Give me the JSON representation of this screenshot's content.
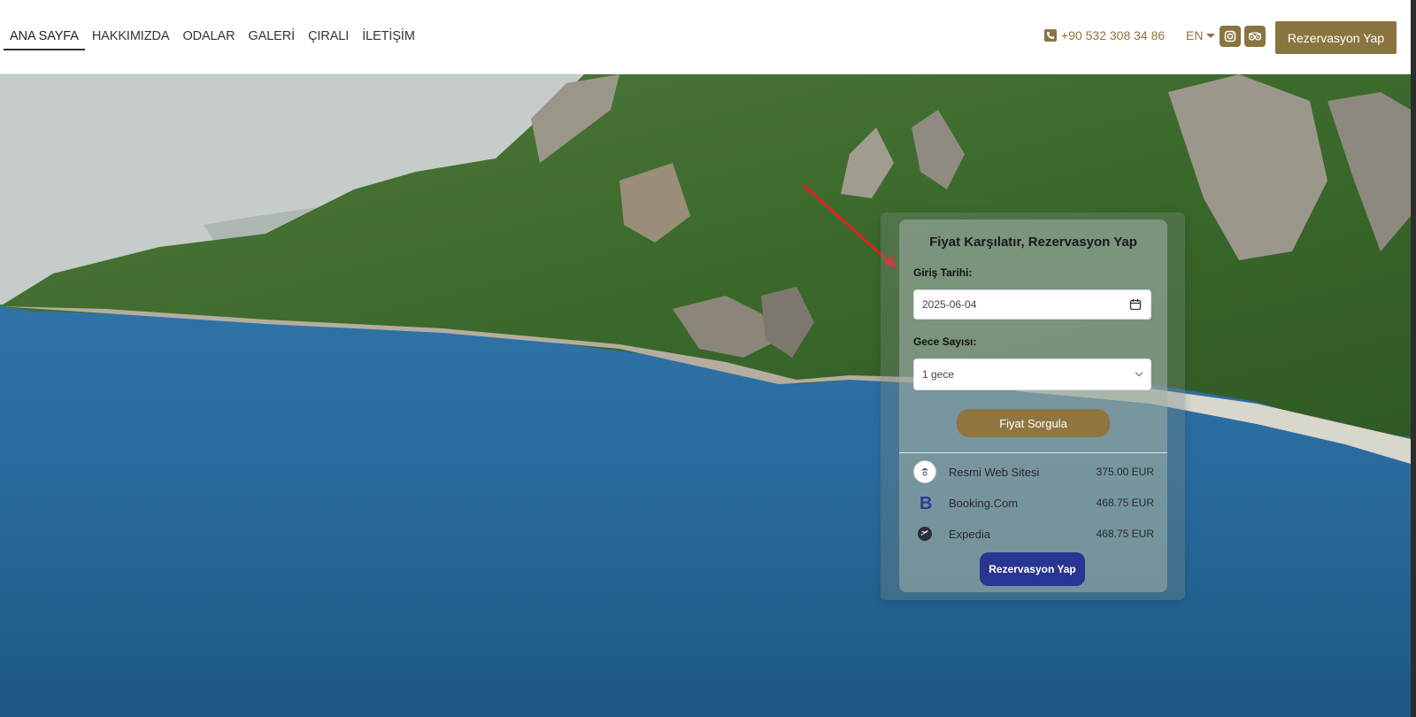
{
  "nav": {
    "items": [
      {
        "label": "ANA SAYFA",
        "active": true
      },
      {
        "label": "HAKKIMIZDA"
      },
      {
        "label": "ODALAR"
      },
      {
        "label": "GALERİ"
      },
      {
        "label": "ÇIRALI"
      },
      {
        "label": "İLETİŞİM"
      }
    ]
  },
  "header": {
    "phone": "+90 532 308 34 86",
    "language": "EN",
    "cta_label": "Rezervasyon Yap",
    "social": [
      "instagram-icon",
      "tripadvisor-icon"
    ]
  },
  "widget": {
    "title": "Fiyat Karşılatır, Rezervasyon Yap",
    "checkin_label": "Giriş Tarihi:",
    "checkin_value": "2025-06-04",
    "nights_label": "Gece Sayısı:",
    "nights_value": "1 gece",
    "query_button": "Fiyat Sorgula",
    "offers": [
      {
        "name": "Resmi Web Sitesi",
        "price": "375.00 EUR",
        "icon": "official-site-logo-icon"
      },
      {
        "name": "Booking.Com",
        "price": "468.75 EUR",
        "icon": "booking-logo-icon"
      },
      {
        "name": "Expedia",
        "price": "468.75 EUR",
        "icon": "expedia-logo-icon"
      }
    ],
    "book_button": "Rezervasyon Yap"
  },
  "colors": {
    "brand_gold": "#8a7440",
    "cta_blue": "#283593",
    "annotation_arrow": "#e02020"
  }
}
